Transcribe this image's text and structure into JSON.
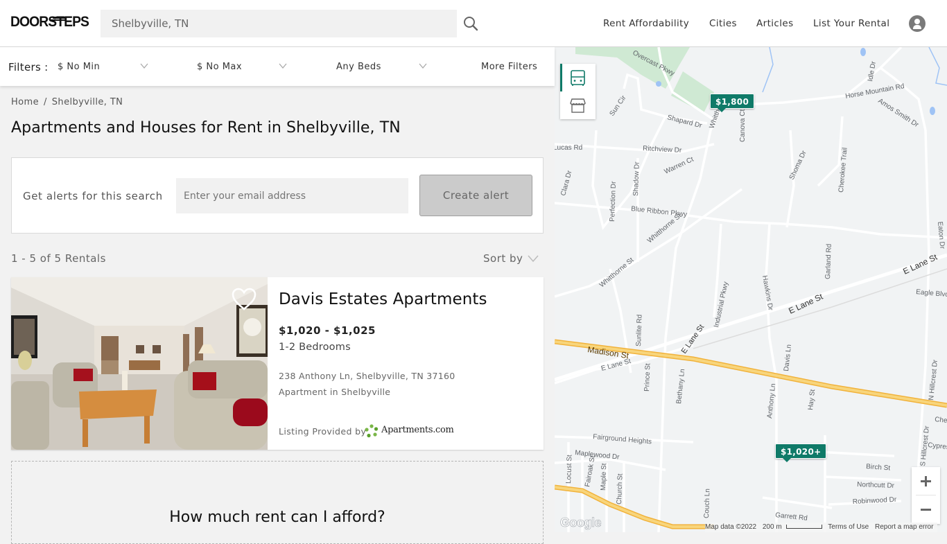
{
  "header": {
    "logo": "DOORSTEPS",
    "search_value": "Shelbyville, TN",
    "nav": [
      "Rent Affordability",
      "Cities",
      "Articles",
      "List Your Rental"
    ]
  },
  "filters": {
    "label": "Filters :",
    "min_price": "$ No Min",
    "max_price": "$ No Max",
    "beds": "Any Beds",
    "more": "More Filters"
  },
  "breadcrumb": [
    "Home",
    "Shelbyville, TN"
  ],
  "breadcrumb_sep": "/",
  "page_title": "Apartments and Houses for Rent in Shelbyville, TN",
  "alert": {
    "label": "Get alerts for this search",
    "email_placeholder": "Enter your email address",
    "button": "Create alert"
  },
  "results": {
    "count": "1 - 5 of 5 Rentals",
    "sort_label": "Sort by"
  },
  "listings": [
    {
      "name": "Davis Estates Apartments",
      "price": "$1,020 - $1,025",
      "beds": "1-2 Bedrooms",
      "address": "238 Anthony Ln, Shelbyville, TN 37160",
      "type": "Apartment in Shelbyville",
      "provided_by_label": "Listing Provided by",
      "provider": "Apartments.com",
      "favorited": false
    }
  ],
  "afford": {
    "title": "How much rent can I afford?"
  },
  "map": {
    "pins": [
      "$1,800",
      "$1,020+"
    ],
    "streets": {
      "overcast": "Overcast Pkwy",
      "sun": "Sun Cir",
      "shapard": "Shapard Dr",
      "whitt": "Whitthorne",
      "canova": "Canova Ct",
      "horse": "Horse Mountain Rd",
      "idle": "Idle Dr",
      "amos": "Amos Smith Dr",
      "lucas": "Lucas Rd",
      "ritchview": "Ritchview Dr",
      "warren": "Warren Ct",
      "clara": "Clara Dr",
      "shadow": "Shadow Dr",
      "perfection": "Perfection Dr",
      "shoma": "Shoma Dr",
      "cherokee": "Cherokee Trail",
      "blue_ribbon": "Blue Ribbon Pkwy",
      "whitthorne1": "Whitthorne St",
      "whitthorne2": "Whitthorne St",
      "eaton": "Eaton Dr",
      "elane1": "E Lane St",
      "elane2": "E Lane St",
      "elane3": "E Lane St",
      "elane4": "E Lane St",
      "eagle": "Eagle Blvd",
      "garland": "Garland Rd",
      "hawkins": "Hawkins Dr",
      "industrial": "Industrial Pkwy",
      "madison": "Madison St",
      "sunlite": "Sunlite Rd",
      "prince": "Prince St",
      "bethany": "Bethany Ln",
      "davis": "Davis Ln",
      "anthony": "Anthony Ln",
      "hay": "Hay St",
      "nhillcrest": "N Hillcrest Dr",
      "shillcrest": "S Hillcrest Dr",
      "cherry": "Cherry",
      "cypress": "Cypress",
      "fairground": "Fairground Heights",
      "maplewood": "Maplewood Dr",
      "locust": "Locust St",
      "fairoak": "Fairoak St",
      "maple": "Maple St",
      "church": "Church St",
      "couch": "Couch Ln",
      "garrett": "Garrett Rd",
      "birch": "Birch St",
      "northcutt": "Northcutt Dr",
      "robinwood": "Robinwood Dr"
    },
    "google": "Google",
    "map_data": "Map data ©2022",
    "scale": "200 m",
    "terms": "Terms of Use",
    "report": "Report a map error"
  },
  "colors": {
    "brand_green": "#0f7a68",
    "highway_yellow": "#f6c65a"
  }
}
